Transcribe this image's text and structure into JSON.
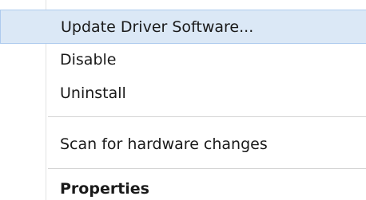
{
  "context_menu": {
    "items": [
      {
        "label": "Update Driver Software...",
        "highlighted": true
      },
      {
        "label": "Disable"
      },
      {
        "label": "Uninstall"
      },
      {
        "label": "Scan for hardware changes"
      },
      {
        "label": "Properties",
        "bold": true
      }
    ],
    "colors": {
      "highlight_bg": "#dbe8f6",
      "highlight_border": "#aecbee",
      "text": "#1a1a1a",
      "separator": "#d5d5d5"
    }
  }
}
